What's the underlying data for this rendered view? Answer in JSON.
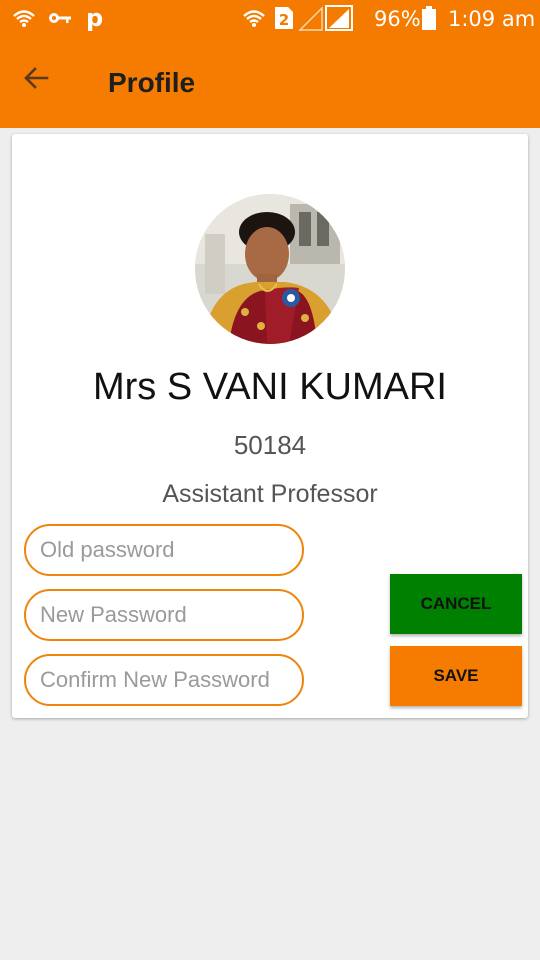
{
  "status_bar": {
    "battery_percent": "96%",
    "time": "1:09 am",
    "sim_number": "2",
    "icons": [
      "wifi-icon",
      "key-icon",
      "p-app-icon",
      "wifi-calling-icon",
      "sim-2-icon",
      "signal-icon",
      "battery-icon"
    ]
  },
  "header": {
    "title": "Profile",
    "back_icon": "arrow-left-icon"
  },
  "profile": {
    "name": "Mrs S VANI KUMARI",
    "employee_id": "50184",
    "designation": "Assistant Professor"
  },
  "form": {
    "old_password_placeholder": "Old password",
    "new_password_placeholder": "New Password",
    "confirm_password_placeholder": "Confirm New Password"
  },
  "buttons": {
    "cancel_label": "CANCEL",
    "save_label": "SAVE"
  },
  "colors": {
    "primary": "#f57c00",
    "cancel": "#008000",
    "input_border": "#f0840a",
    "background": "#eeeeee"
  }
}
